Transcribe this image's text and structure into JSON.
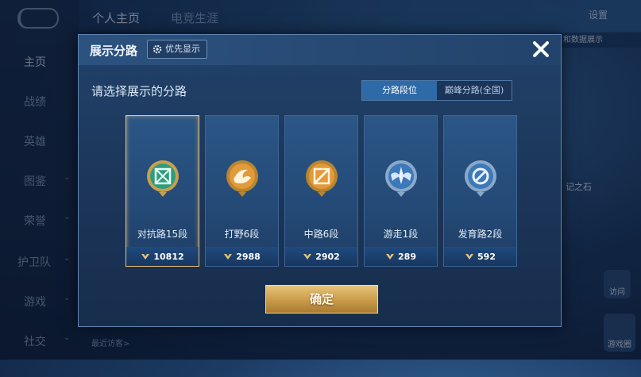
{
  "background": {
    "tabs": [
      "个人主页",
      "电竞生涯"
    ],
    "settings_label": "设置",
    "nav": [
      {
        "label": "主页",
        "active": true,
        "arrow": false
      },
      {
        "label": "战绩",
        "active": false,
        "arrow": false
      },
      {
        "label": "英雄",
        "active": false,
        "arrow": false
      },
      {
        "label": "图鉴",
        "active": false,
        "arrow": true
      },
      {
        "label": "荣誉",
        "active": false,
        "arrow": true
      },
      {
        "label": "护卫队",
        "active": false,
        "arrow": true
      },
      {
        "label": "游戏",
        "active": false,
        "arrow": true
      },
      {
        "label": "社交",
        "active": false,
        "arrow": true
      }
    ],
    "right_tag": "和数据展示",
    "mid_tag": "记之石",
    "recent_visitors": "最近访客>",
    "btn_a": "访问",
    "btn_b": "游戏圈"
  },
  "modal": {
    "title": "展示分路",
    "priority_label": "优先显示",
    "subtitle": "请选择展示的分路",
    "toggle": [
      "分路段位",
      "巅峰分路(全国)"
    ],
    "toggle_active_index": 0,
    "confirm_label": "确定",
    "cards": [
      {
        "label": "对抗路15段",
        "points": "10812",
        "selected": true,
        "emblem": "teal-cross-emblem"
      },
      {
        "label": "打野6段",
        "points": "2988",
        "selected": false,
        "emblem": "orange-wave-emblem"
      },
      {
        "label": "中路6段",
        "points": "2902",
        "selected": false,
        "emblem": "orange-slash-emblem"
      },
      {
        "label": "游走1段",
        "points": "289",
        "selected": false,
        "emblem": "blue-wing-emblem"
      },
      {
        "label": "发育路2段",
        "points": "592",
        "selected": false,
        "emblem": "blue-circle-emblem"
      }
    ]
  },
  "colors": {
    "accent_gold": "#e7c37a",
    "selected_border": "#f0c27a",
    "toggle_active": "#2f6aa8"
  }
}
